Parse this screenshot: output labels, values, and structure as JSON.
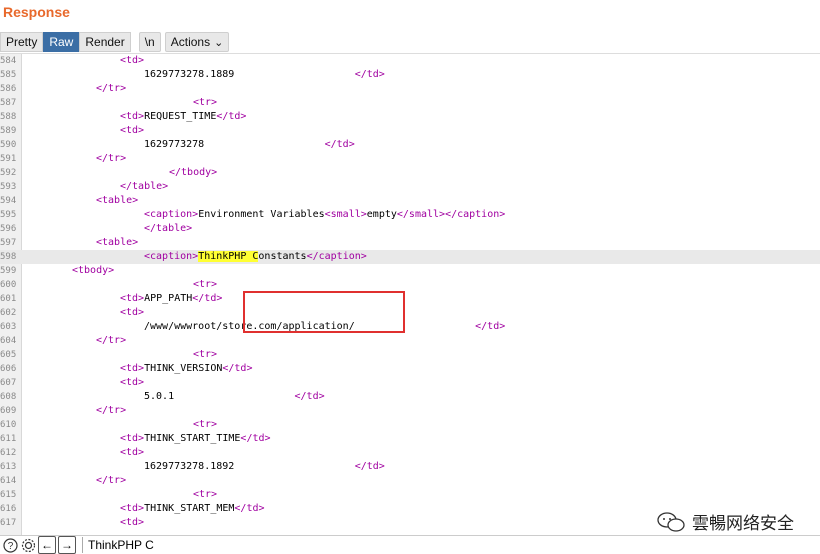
{
  "panel": {
    "title": "Response"
  },
  "toolbar": {
    "pretty": "Pretty",
    "raw": "Raw",
    "render": "Render",
    "newline": "\\n",
    "actions": "Actions"
  },
  "lines": [
    {
      "n": "584",
      "indent": 20,
      "parts": [
        {
          "t": "<td>",
          "c": "tag"
        }
      ]
    },
    {
      "n": "585",
      "indent": 24,
      "parts": [
        {
          "t": "1629773278.1889                    ",
          "c": ""
        },
        {
          "t": "</td>",
          "c": "tag"
        }
      ]
    },
    {
      "n": "586",
      "indent": 16,
      "parts": [
        {
          "t": "</tr>",
          "c": "tag"
        }
      ]
    },
    {
      "n": "587",
      "indent": 32,
      "parts": [
        {
          "t": "<tr>",
          "c": "tag"
        }
      ]
    },
    {
      "n": "588",
      "indent": 20,
      "parts": [
        {
          "t": "<td>",
          "c": "tag"
        },
        {
          "t": "REQUEST_TIME",
          "c": ""
        },
        {
          "t": "</td>",
          "c": "tag"
        }
      ]
    },
    {
      "n": "589",
      "indent": 20,
      "parts": [
        {
          "t": "<td>",
          "c": "tag"
        }
      ]
    },
    {
      "n": "590",
      "indent": 24,
      "parts": [
        {
          "t": "1629773278                    ",
          "c": ""
        },
        {
          "t": "</td>",
          "c": "tag"
        }
      ]
    },
    {
      "n": "591",
      "indent": 16,
      "parts": [
        {
          "t": "</tr>",
          "c": "tag"
        }
      ]
    },
    {
      "n": "592",
      "indent": 28,
      "parts": [
        {
          "t": "</tbody>",
          "c": "tag"
        }
      ]
    },
    {
      "n": "593",
      "indent": 20,
      "parts": [
        {
          "t": "</table>",
          "c": "tag"
        }
      ]
    },
    {
      "n": "594",
      "indent": 16,
      "parts": [
        {
          "t": "<table>",
          "c": "tag"
        }
      ]
    },
    {
      "n": "595",
      "indent": 24,
      "parts": [
        {
          "t": "<caption>",
          "c": "tag"
        },
        {
          "t": "Environment Variables",
          "c": ""
        },
        {
          "t": "<small>",
          "c": "tag"
        },
        {
          "t": "empty",
          "c": ""
        },
        {
          "t": "</small>",
          "c": "tag"
        },
        {
          "t": "</caption>",
          "c": "tag"
        }
      ]
    },
    {
      "n": "596",
      "indent": 24,
      "parts": [
        {
          "t": "</table>",
          "c": "tag"
        }
      ]
    },
    {
      "n": "597",
      "indent": 16,
      "parts": [
        {
          "t": "<table>",
          "c": "tag"
        }
      ]
    },
    {
      "n": "598",
      "indent": 24,
      "hl": true,
      "parts": [
        {
          "t": "<caption>",
          "c": "tag"
        },
        {
          "t": "ThinkPHP C",
          "c": "hlt"
        },
        {
          "t": "onstants",
          "c": ""
        },
        {
          "t": "</caption>",
          "c": "tag"
        }
      ]
    },
    {
      "n": "599",
      "indent": 12,
      "parts": [
        {
          "t": "<tbody>",
          "c": "tag"
        }
      ]
    },
    {
      "n": "600",
      "indent": 32,
      "parts": [
        {
          "t": "<tr>",
          "c": "tag"
        }
      ]
    },
    {
      "n": "601",
      "indent": 20,
      "parts": [
        {
          "t": "<td>",
          "c": "tag"
        },
        {
          "t": "APP_PATH",
          "c": ""
        },
        {
          "t": "</td>",
          "c": "tag"
        }
      ]
    },
    {
      "n": "602",
      "indent": 20,
      "parts": [
        {
          "t": "<td>",
          "c": "tag"
        }
      ]
    },
    {
      "n": "603",
      "indent": 24,
      "parts": [
        {
          "t": "/www/wwwroot/store.com/application/                    ",
          "c": ""
        },
        {
          "t": "</td>",
          "c": "tag"
        }
      ]
    },
    {
      "n": "604",
      "indent": 16,
      "parts": [
        {
          "t": "</tr>",
          "c": "tag"
        }
      ]
    },
    {
      "n": "605",
      "indent": 32,
      "parts": [
        {
          "t": "<tr>",
          "c": "tag"
        }
      ]
    },
    {
      "n": "606",
      "indent": 20,
      "parts": [
        {
          "t": "<td>",
          "c": "tag"
        },
        {
          "t": "THINK_VERSION",
          "c": ""
        },
        {
          "t": "</td>",
          "c": "tag"
        }
      ]
    },
    {
      "n": "607",
      "indent": 20,
      "parts": [
        {
          "t": "<td>",
          "c": "tag"
        }
      ]
    },
    {
      "n": "608",
      "indent": 24,
      "parts": [
        {
          "t": "5.0.1                    ",
          "c": ""
        },
        {
          "t": "</td>",
          "c": "tag"
        }
      ]
    },
    {
      "n": "609",
      "indent": 16,
      "parts": [
        {
          "t": "</tr>",
          "c": "tag"
        }
      ]
    },
    {
      "n": "610",
      "indent": 32,
      "parts": [
        {
          "t": "<tr>",
          "c": "tag"
        }
      ]
    },
    {
      "n": "611",
      "indent": 20,
      "parts": [
        {
          "t": "<td>",
          "c": "tag"
        },
        {
          "t": "THINK_START_TIME",
          "c": ""
        },
        {
          "t": "</td>",
          "c": "tag"
        }
      ]
    },
    {
      "n": "612",
      "indent": 20,
      "parts": [
        {
          "t": "<td>",
          "c": "tag"
        }
      ]
    },
    {
      "n": "613",
      "indent": 24,
      "parts": [
        {
          "t": "1629773278.1892                    ",
          "c": ""
        },
        {
          "t": "</td>",
          "c": "tag"
        }
      ]
    },
    {
      "n": "614",
      "indent": 16,
      "parts": [
        {
          "t": "</tr>",
          "c": "tag"
        }
      ]
    },
    {
      "n": "615",
      "indent": 32,
      "parts": [
        {
          "t": "<tr>",
          "c": "tag"
        }
      ]
    },
    {
      "n": "616",
      "indent": 20,
      "parts": [
        {
          "t": "<td>",
          "c": "tag"
        },
        {
          "t": "THINK_START_MEM",
          "c": ""
        },
        {
          "t": "</td>",
          "c": "tag"
        }
      ]
    },
    {
      "n": "617",
      "indent": 20,
      "parts": [
        {
          "t": "<td>",
          "c": "tag"
        }
      ]
    }
  ],
  "search": {
    "value": "ThinkPHP C"
  },
  "watermark": {
    "text": "雲暢网络安全"
  },
  "colors": {
    "accent": "#e8692c",
    "tag": "#a000a0",
    "highlight": "#ffff33",
    "box": "#e0302f"
  }
}
